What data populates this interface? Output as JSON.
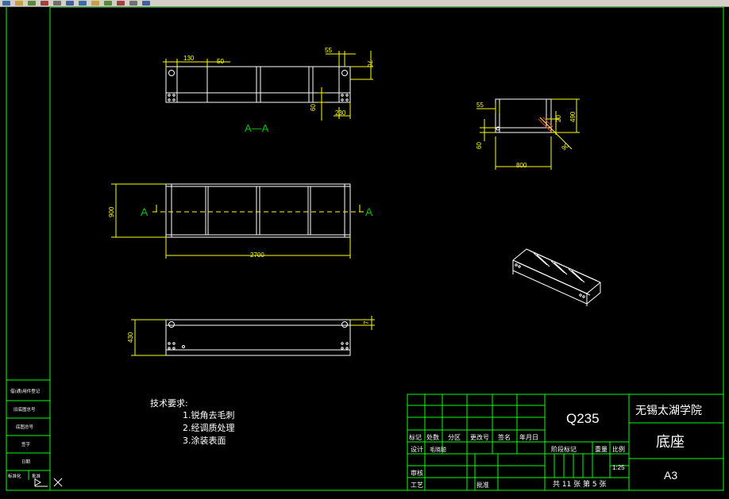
{
  "colors": {
    "background": "#000000",
    "border": "#00ff00",
    "geometry": "#ffffff",
    "dimension": "#ffff00",
    "label": "#00c000",
    "toolbar": "#d4d0c8"
  },
  "toolbar": {
    "icons": [
      "new-icon",
      "open-icon",
      "save-icon",
      "print-icon",
      "cut-icon",
      "copy-icon",
      "paste-icon",
      "undo-icon",
      "pan-icon",
      "zoom-icon",
      "properties-icon",
      "help-icon"
    ]
  },
  "drawing": {
    "section_label": "A—A",
    "cut_label_left": "A",
    "cut_label_right": "A",
    "dims": {
      "d130": "130",
      "d50": "50",
      "d55a": "55",
      "d70": "70",
      "d60a": "60",
      "d230": "230",
      "d55b": "55",
      "d20": "20",
      "d490": "490",
      "d60b": "60",
      "d800": "800",
      "d90": "90",
      "d900": "900",
      "d2700": "2700",
      "d430": "430",
      "d7": "7"
    }
  },
  "tech_req": {
    "title": "技术要求:",
    "items": [
      "1.锐角去毛刺",
      "2.经调质处理",
      "3.涂装表面"
    ]
  },
  "side_table": {
    "rows": [
      "借(通)用件登记",
      "旧底图总号",
      "底图总号",
      "签字",
      "日期"
    ],
    "bottom_left": "标准化",
    "bottom_right": "批准"
  },
  "title_block": {
    "material": "Q235",
    "school": "无锡太湖学院",
    "part_name": "底座",
    "sheet_size": "A3",
    "headers": [
      "标记",
      "处数",
      "分区",
      "更改号",
      "签名",
      "年月日"
    ],
    "design_label": "设计",
    "designer": "毛晓聪",
    "review_label": "审核",
    "process_label": "工艺",
    "approve_label": "批准",
    "stage_label": "阶段标记",
    "weight_label": "重量",
    "scale_label": "比例",
    "scale": "1:25",
    "sheet_info": "共 11 张 第 5 张"
  }
}
